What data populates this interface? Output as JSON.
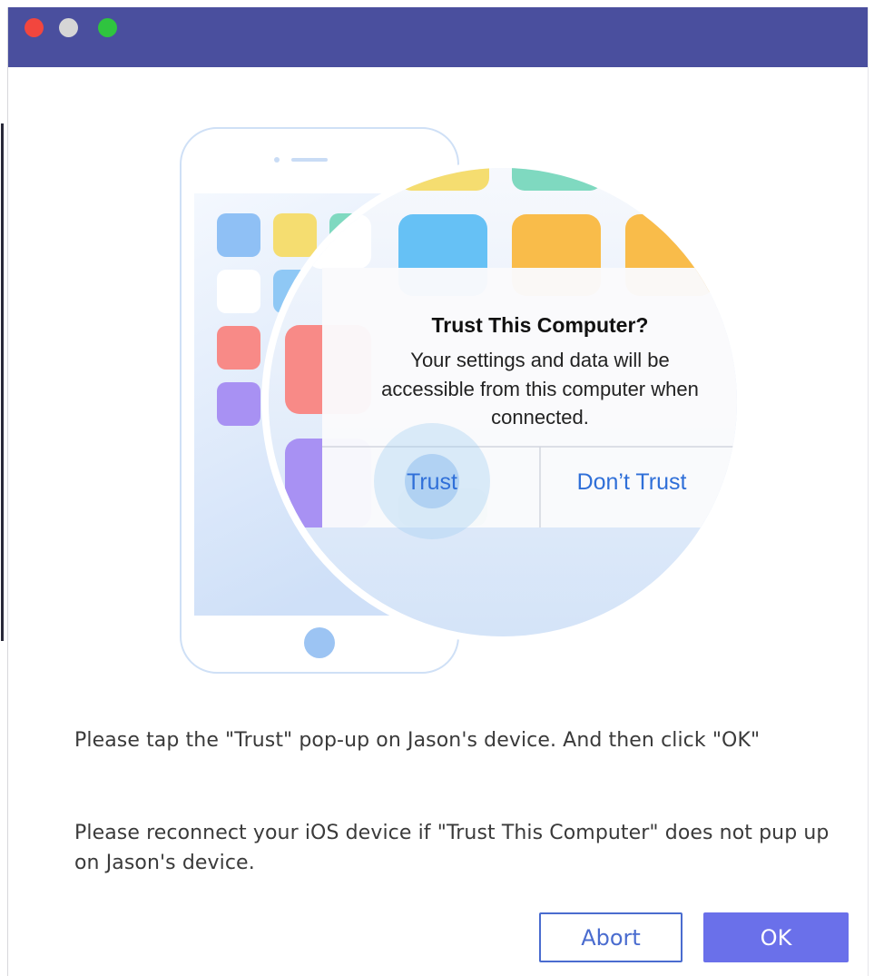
{
  "window": {
    "title_bar_color": "#4a4f9e",
    "traffic_lights": [
      "close",
      "minimize",
      "maximize"
    ]
  },
  "illustration": {
    "dialog_title": "Trust This Computer?",
    "dialog_message_lines": [
      "Your settings and data will be",
      "accessible from this computer when",
      "connected."
    ],
    "trust_label": "Trust",
    "dont_trust_label": "Don’t Trust",
    "accent_color": "#2f6fd8"
  },
  "instructions": {
    "line1": "Please tap the \"Trust\" pop-up on Jason's device. And then click \"OK\"",
    "line2": "Please reconnect your iOS device if \"Trust This Computer\" does not pup up on Jason's device."
  },
  "buttons": {
    "abort_label": "Abort",
    "ok_label": "OK",
    "ok_color": "#6a70ea"
  }
}
